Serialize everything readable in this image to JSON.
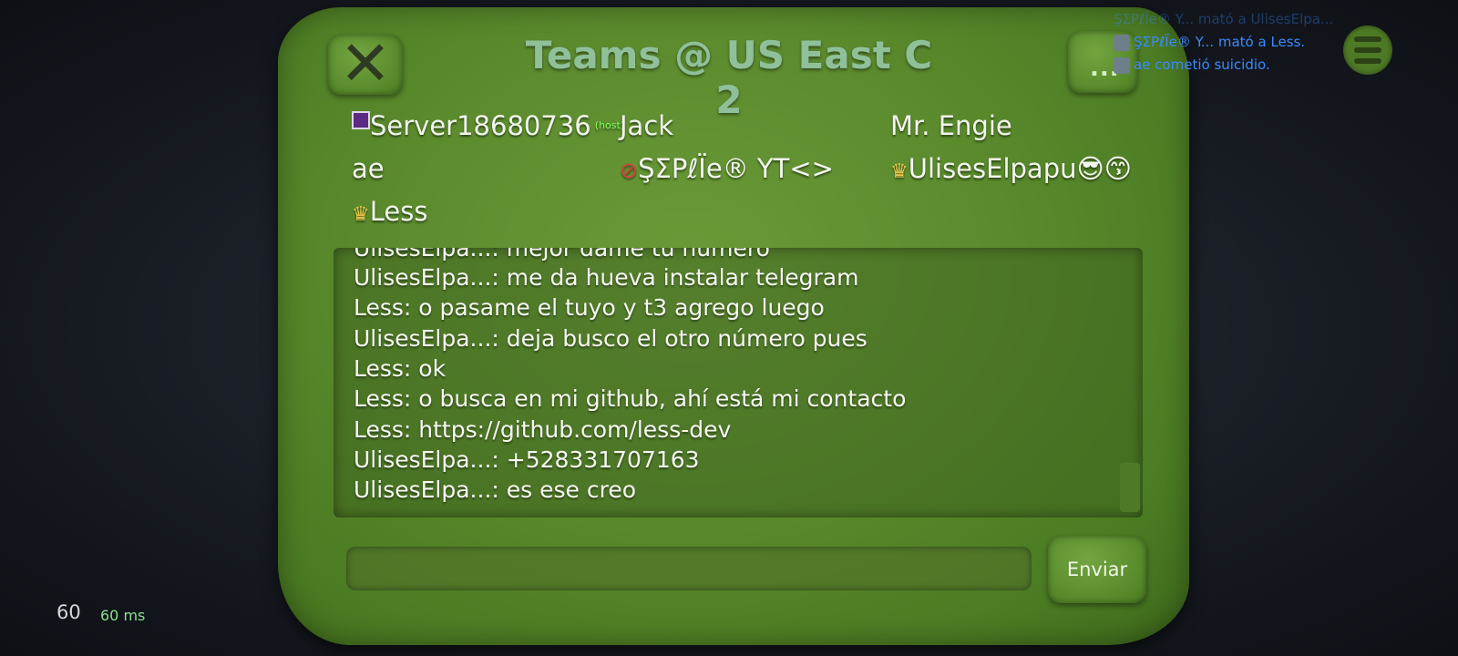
{
  "header": {
    "title": "Teams @ US East C 2",
    "more_label": "..."
  },
  "players": [
    {
      "name": "Server18680736",
      "tag": "(host)"
    },
    {
      "name": "Jack"
    },
    {
      "name": "Mr. Engie"
    },
    {
      "name": "ae"
    },
    {
      "name": "ŞΣPℓÏe® YT<>"
    },
    {
      "name": "UlisesElpapu😎😙"
    },
    {
      "name": "Less"
    }
  ],
  "chat": {
    "messages": [
      "UlisesElpa...: mejor dame tu número",
      "UlisesElpa...: me da hueva instalar telegram",
      "Less: o pasame el tuyo y t3 agrego luego",
      "UlisesElpa...: deja busco el otro número pues",
      "Less: ok",
      "Less: o busca en mi github, ahí está mi contacto",
      "Less: https://github.com/less-dev",
      "UlisesElpa...: +528331707163",
      "UlisesElpa...: es ese creo"
    ],
    "input_value": "",
    "send_label": "Enviar"
  },
  "killfeed": [
    "ŞΣPℓÏe® Y... mató a UlisesElpa...",
    "ŞΣPℓÏe® Y... mató a Less.",
    "ae cometió suicidio."
  ],
  "stats": {
    "fps": "60",
    "ping": "60 ms"
  },
  "colors": {
    "panel": "#5a8a2c",
    "title": "#8fc09a",
    "killfeed": "#3a8aff",
    "ping": "#8fe08f"
  }
}
